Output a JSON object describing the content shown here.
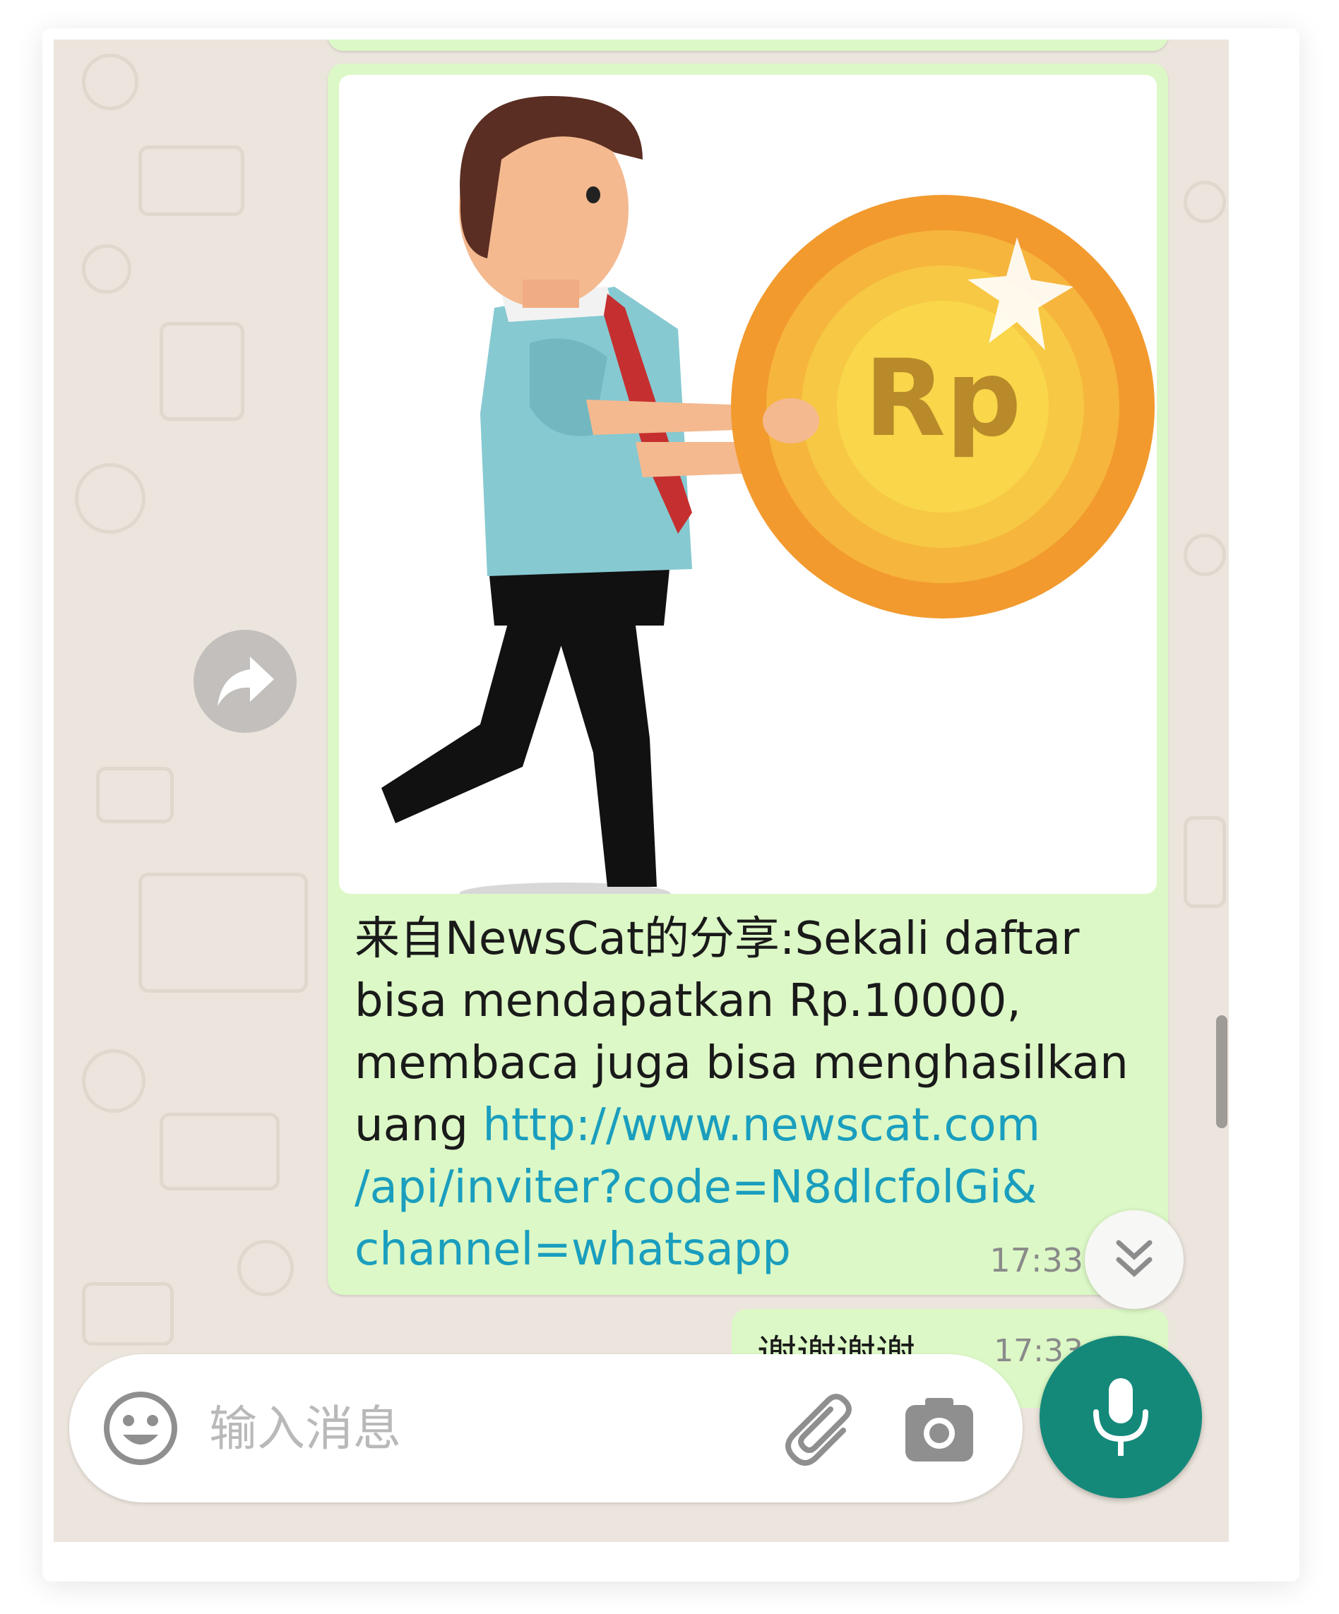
{
  "chat": {
    "message": {
      "text_main": "来自NewsCat的分享:Sekali daftar\nbisa mendapatkan Rp.10000,\nmembaca juga bisa menghasilkan\nuang ",
      "link": "http://www.newscat.com\n/api/inviter?code=N8dlcfolGi&\nchannel=whatsapp",
      "time": "17:33",
      "image_label": "Rp"
    },
    "reply": {
      "text": "谢谢谢谢",
      "time": "17:33",
      "ticks": "✓✓"
    }
  },
  "input": {
    "placeholder": "输入消息"
  },
  "icons": {
    "forward": "forward-icon",
    "scroll_down": "double-chevron-down-icon",
    "emoji": "emoji-icon",
    "attach": "paperclip-icon",
    "camera": "camera-icon",
    "mic": "microphone-icon"
  },
  "colors": {
    "outgoing_bubble": "#dcf8c6",
    "link": "#1a9ebe",
    "mic_button": "#14897a",
    "wallpaper": "#ece5dd"
  }
}
